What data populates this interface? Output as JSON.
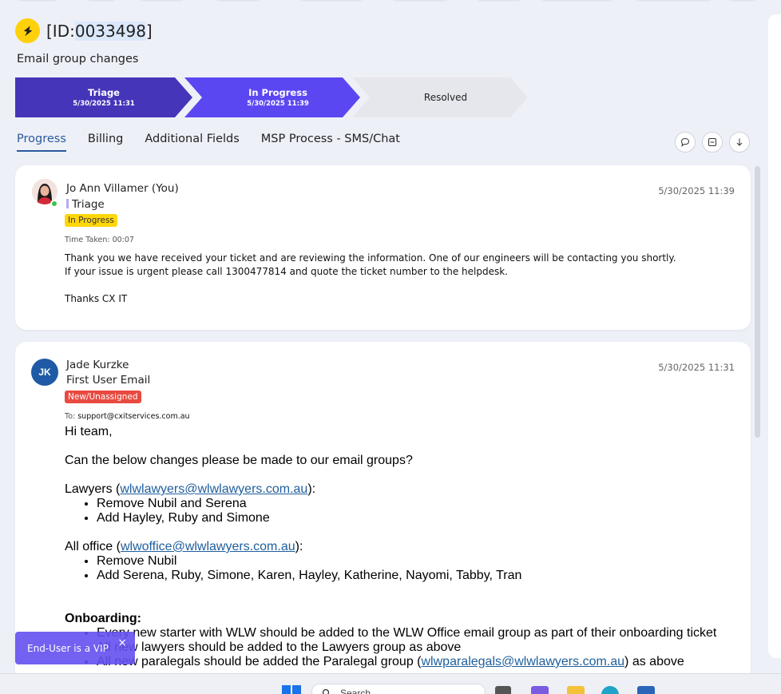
{
  "ticket": {
    "id_prefix": "[ID:",
    "id_number": "0033498",
    "id_suffix": "]",
    "subject": "Email group changes"
  },
  "stepper": [
    {
      "title": "Triage",
      "date": "5/30/2025 11:31"
    },
    {
      "title": "In Progress",
      "date": "5/30/2025 11:39"
    },
    {
      "title": "Resolved",
      "date": ""
    }
  ],
  "tabs": [
    "Progress",
    "Billing",
    "Additional Fields",
    "MSP Process - SMS/Chat"
  ],
  "toolbar": {
    "icons": [
      "comment-icon",
      "collapse-icon",
      "download-icon"
    ]
  },
  "entries": [
    {
      "author": "Jo Ann Villamer (You)",
      "status_line": "Triage",
      "badge": "In Progress",
      "time_taken": "Time Taken: 00:07",
      "timestamp": "5/30/2025 11:39",
      "body_line1": "Thank you we have received your ticket and are reviewing the information. One of our engineers will be contacting you shortly.",
      "body_line2": "If your issue is urgent please call 1300477814 and quote the ticket number to the helpdesk.",
      "body_line3": "Thanks CX IT"
    },
    {
      "initials": "JK",
      "author": "Jade Kurzke",
      "status_line": "First User Email",
      "badge": "New/Unassigned",
      "to_label": "To:",
      "to_address": "support@cxitservices.com.au",
      "timestamp": "5/30/2025 11:31",
      "greeting": "Hi team,",
      "intro": "Can the below changes please be made to our email groups?",
      "lawyers_prefix": "Lawyers (",
      "lawyers_email": "wlwlawyers@wlwlawyers.com.au",
      "lawyers_suffix": "):",
      "lawyers_items": [
        "Remove Nubil and Serena",
        "Add Hayley, Ruby and Simone"
      ],
      "office_prefix": "All office (",
      "office_email": "wlwoffice@wlwlawyers.com.au",
      "office_suffix": "):",
      "office_items": [
        "Remove Nubil",
        "Add Serena, Ruby, Simone, Karen, Hayley, Katherine, Nayomi, Tabby, Tran"
      ],
      "onboarding_heading": "Onboarding:",
      "onboarding_1": "Every new starter with WLW should be added to the WLW Office email group as part of their onboarding ticket",
      "onboarding_2": "All new lawyers should be added to the Lawyers group as above",
      "onboarding_3_prefix": "All new paralegals should be added the Paralegal group (",
      "onboarding_3_email": "wlwparalegals@wlwlawyers.com.au",
      "onboarding_3_suffix": ") as above"
    }
  ],
  "vip_toast": {
    "text": "End-User is a VIP",
    "close": "×"
  },
  "taskbar": {
    "search_placeholder": "Search"
  },
  "colors": {
    "accent": "#5b47f2",
    "triage": "#4535b9",
    "badge_yellow": "#ffd60a",
    "badge_red": "#e84a40",
    "link": "#1f5e9c"
  }
}
